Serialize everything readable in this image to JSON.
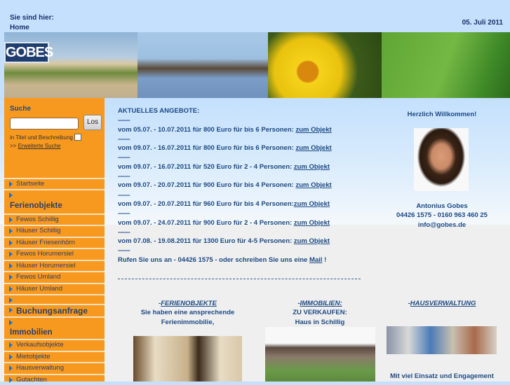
{
  "header": {
    "breadcrumb_label": "Sie sind hier:",
    "breadcrumb_current": "Home",
    "date": "05. Juli 2011",
    "logo_text": "GOBES"
  },
  "search": {
    "heading": "Suche",
    "input_value": "",
    "button": "Los",
    "checkbox_label": "in Titel und Beschreibung",
    "advanced_prefix": ">>",
    "advanced_link": "Erweiterte Suche"
  },
  "nav": {
    "start": "Startseite",
    "ferien_heading": "Ferienobjekte",
    "ferien": [
      "Fewos Schillig",
      "Häuser Schillig",
      "Häuser Friesenhörn",
      "Fewos Horumersiel",
      "Häuser Horumersiel",
      "Fewos Umland",
      "Häuser Umland"
    ],
    "booking": "Buchungsanfrage",
    "immo_heading": "Immobilien",
    "immo": [
      "Verkaufsobjekte",
      "Mietobjekte",
      "Hausverwaltung",
      "Gutachten"
    ]
  },
  "offers": {
    "title": "AKTUELLES ANGEBOTE:",
    "separator": "----------",
    "link": "zum Objekt",
    "items": [
      "vom 05.07. - 10.07.2011 für 800 Euro für bis 6 Personen: ",
      "vom 09.07. - 16.07.2011 für 800 Euro für bis 6 Personen: ",
      "vom 09.07. - 16.07.2011 für 520 Euro für 2 - 4 Personen: ",
      "vom 09.07. - 20.07.2011 für 900 Euro für bis 4 Personen: ",
      "vom 09.07. - 20.07.2011 für 960 Euro für bis 4 Personen:",
      "vom 09.07. - 24.07.2011 für 900 Euro für 2 - 4 Personen: ",
      "vom 07.08. - 19.08.2011 für 1300 Euro für 4-5 Personen: "
    ],
    "call_text": "Rufen Sie uns an - 04426 1575 - oder schreiben Sie uns eine ",
    "mail_link": "Mail",
    "call_end": " !"
  },
  "welcome": {
    "title": "Herzlich Willkommen!",
    "name": "Antonius Gobes",
    "phone": "04426 1575 - 0160 963 460 25",
    "email": "info@gobes.de"
  },
  "columns": [
    {
      "prefix": "-",
      "link": "FERIENOBJEKTE",
      "line1": "Sie haben eine ansprechende",
      "line2": "Ferienimmobilie,"
    },
    {
      "prefix": "-",
      "link": "IMMOBILIEN:",
      "line1": "ZU VERKAUFEN:",
      "line2": "Haus in Schillig"
    },
    {
      "prefix": "-",
      "link": "HAUSVERWALTUNG",
      "line1": "Mit viel Einsatz und Engagement"
    }
  ]
}
